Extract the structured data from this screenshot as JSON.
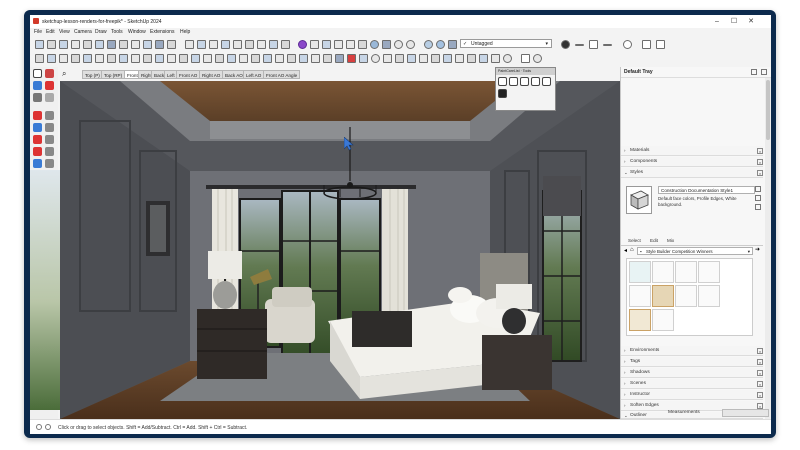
{
  "window": {
    "title": "sketchup-lesson-renders-for-freepik* - SketchUp 2024",
    "minimize": "–",
    "maximize": "☐",
    "close": "✕"
  },
  "menu": [
    "File",
    "Edit",
    "View",
    "Camera",
    "Draw",
    "Tools",
    "Window",
    "Extensions",
    "Help"
  ],
  "toolbar": {
    "tag_select": "Untagged",
    "tag_check": "✓",
    "tag_caret": "▾"
  },
  "scene_tabs": [
    "Top (P)",
    "Top (RP)",
    "Front",
    "Right",
    "Back",
    "Left",
    "Front AO",
    "Right AO",
    "Back AO",
    "Left AO",
    "Front AO Angle"
  ],
  "active_scene": "Front",
  "float_window": {
    "title": "PaintCareList · Tools"
  },
  "tray": {
    "title": "Default Tray",
    "panels_top": [
      "Materials",
      "Components",
      "Styles"
    ],
    "style_name": "Construction Documentation Style1",
    "style_description": "Default face colors, Profile Edges, White background.",
    "subtabs": [
      "Select",
      "Edit",
      "Mix"
    ],
    "collection": "Style Builder Competition Winners",
    "panels_bottom": [
      "Environments",
      "Tags",
      "Shadows",
      "Scenes",
      "Instructor",
      "Soften Edges",
      "Outliner"
    ],
    "arrow_collapsed": "›",
    "arrow_expanded": "⌄",
    "panel_close": "×"
  },
  "measurements": {
    "label": "Measurements",
    "value": ""
  },
  "status": {
    "hint": "Click or drag to select objects. Shift = Add/Subtract. Ctrl = Add. Shift + Ctrl = Subtract."
  },
  "colors": {
    "frame": "#0c2a4d",
    "wall": "#6e7076",
    "ceiling_wood": "#6b4a2e",
    "floor_wood": "#5a3b22",
    "rug": "#7c7f82",
    "drapes": "#e8e6de",
    "window_view": "#46613a",
    "bedding": "#f2f1ec",
    "headboard": "#8d8b84",
    "nightstand": "#3a3431"
  }
}
